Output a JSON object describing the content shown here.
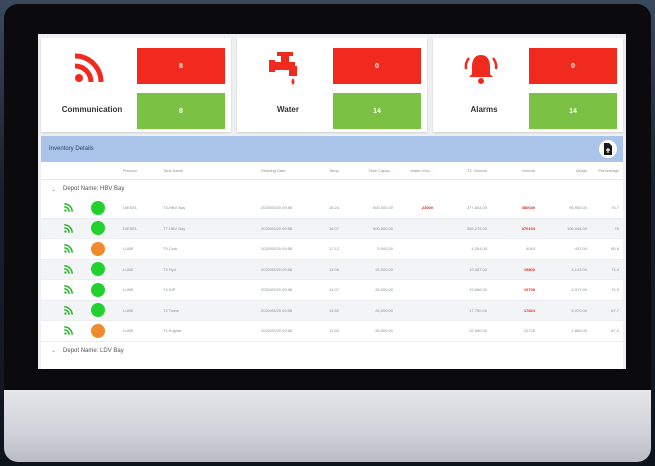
{
  "colors": {
    "alert_red": "#f02a1e",
    "ok_green": "#7bc144",
    "status_green": "#22d12e",
    "status_orange": "#f08a2c",
    "header_blue": "#a9c4e8"
  },
  "cards": [
    {
      "icon": "signal-icon",
      "label": "Communication",
      "red_value": "8",
      "green_value": "8"
    },
    {
      "icon": "water-tap-icon",
      "label": "Water",
      "red_value": "0",
      "green_value": "14"
    },
    {
      "icon": "alarm-bell-icon",
      "label": "Alarms",
      "red_value": "0",
      "green_value": "14"
    }
  ],
  "inventory": {
    "title": "Inventory Details",
    "export_icon": "export-file-icon"
  },
  "table": {
    "columns": [
      "Product",
      "Tank Name",
      "Reading Date",
      "Temp",
      "Tank Capac...",
      "Water Volu...",
      "TC Volume",
      "Volume",
      "Ullage",
      "Percentage"
    ],
    "groups": [
      {
        "name": "Depot Name: HBV Bay",
        "rows": [
          {
            "status": "green",
            "product": "DIESEL",
            "tank": "T3-HBV Bay",
            "date": "2020/05/20 09:58",
            "temp": "18.24",
            "cap": "500,000.00",
            "water": "23000",
            "tcv": "377,844.00",
            "vol": "380049",
            "ull": "96,950.00",
            "pct": "76.7"
          },
          {
            "status": "green",
            "product": "DIESEL",
            "tank": "T7-HBV Bay",
            "date": "2020/05/20 09:58",
            "temp": "16.07",
            "cap": "500,000.00",
            "water": "",
            "tcv": "369,275.00",
            "vol": "370194",
            "ull": "106,944.00",
            "pct": "75"
          },
          {
            "status": "orange",
            "product": "LUBE",
            "tank": "T9 Com",
            "date": "2020/05/20 09:58",
            "temp": "17.12",
            "cap": "5,000.00",
            "water": "",
            "tcv": "4,254.00",
            "vol": "4043",
            "ull": "437.00",
            "pct": "80.8"
          },
          {
            "status": "green",
            "product": "LUBE",
            "tank": "T3 Hyd",
            "date": "2020/05/20 09:58",
            "temp": "14.06",
            "cap": "26,000.00",
            "water": "",
            "tcv": "19,387.00",
            "vol": "19803",
            "ull": "4,143.00",
            "pct": "74.4"
          },
          {
            "status": "green",
            "product": "LUBE",
            "tank": "T4 DIP",
            "date": "2020/05/20 09:58",
            "temp": "14.07",
            "cap": "26,000.00",
            "water": "",
            "tcv": "19,686.00",
            "vol": "19708",
            "ull": "5,317.00",
            "pct": "74.5"
          },
          {
            "status": "green",
            "product": "LUBE",
            "tank": "T2 Trans",
            "date": "2020/05/20 09:58",
            "temp": "14.52",
            "cap": "26,000.00",
            "water": "",
            "tcv": "17,750.00",
            "vol": "17824",
            "ull": "5,070.00",
            "pct": "67.7"
          },
          {
            "status": "orange",
            "product": "LUBE",
            "tank": "T1 Engine",
            "date": "2020/05/20 09:58",
            "temp": "13.94",
            "cap": "26,000.00",
            "water": "",
            "tcv": "22,690.00",
            "vol": "22726",
            "ull": "2,866.00",
            "pct": "87.2"
          }
        ]
      },
      {
        "name": "Depot Name: LDV Bay",
        "rows": []
      }
    ]
  }
}
